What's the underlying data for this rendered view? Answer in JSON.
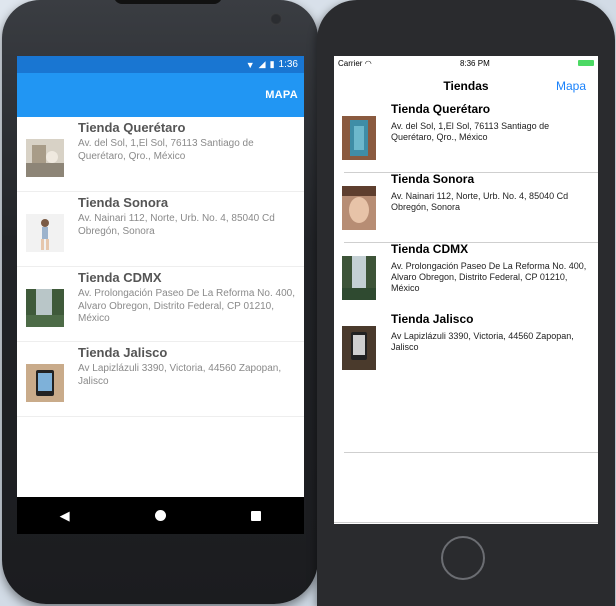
{
  "android": {
    "status": {
      "time": "1:36"
    },
    "appbar": {
      "action_label": "MAPA"
    },
    "stores": [
      {
        "name": "Tienda Querétaro",
        "address": "Av. del Sol, 1,El Sol, 76113 Santiago de Querétaro, Qro., México"
      },
      {
        "name": "Tienda Sonora",
        "address": "Av. Nainari 112, Norte, Urb. No. 4, 85040 Cd Obregón, Sonora"
      },
      {
        "name": "Tienda CDMX",
        "address": "Av. Prolongación Paseo De La Reforma No. 400, Alvaro Obregon, Distrito Federal, CP 01210, México"
      },
      {
        "name": "Tienda Jalisco",
        "address": "Av Lapizlázuli 3390, Victoria, 44560 Zapopan, Jalisco"
      }
    ]
  },
  "ios": {
    "status": {
      "carrier": "Carrier",
      "time": "8:36 PM"
    },
    "nav": {
      "title": "Tiendas",
      "action_label": "Mapa"
    },
    "stores": [
      {
        "name": "Tienda Querétaro",
        "address": "Av. del Sol, 1,El Sol, 76113 Santiago de Querétaro, Qro., México"
      },
      {
        "name": "Tienda Sonora",
        "address": "Av. Nainari 112, Norte, Urb. No. 4, 85040 Cd Obregón, Sonora"
      },
      {
        "name": "Tienda CDMX",
        "address": "Av. Prolongación Paseo De La Reforma No. 400, Alvaro Obregon, Distrito Federal, CP 01210, México"
      },
      {
        "name": "Tienda Jalisco",
        "address": "Av Lapizlázuli 3390, Victoria, 44560 Zapopan, Jalisco"
      }
    ]
  },
  "colors": {
    "android_appbar": "#2196f3",
    "android_status": "#1976d2",
    "ios_accent": "#1a82fb"
  }
}
